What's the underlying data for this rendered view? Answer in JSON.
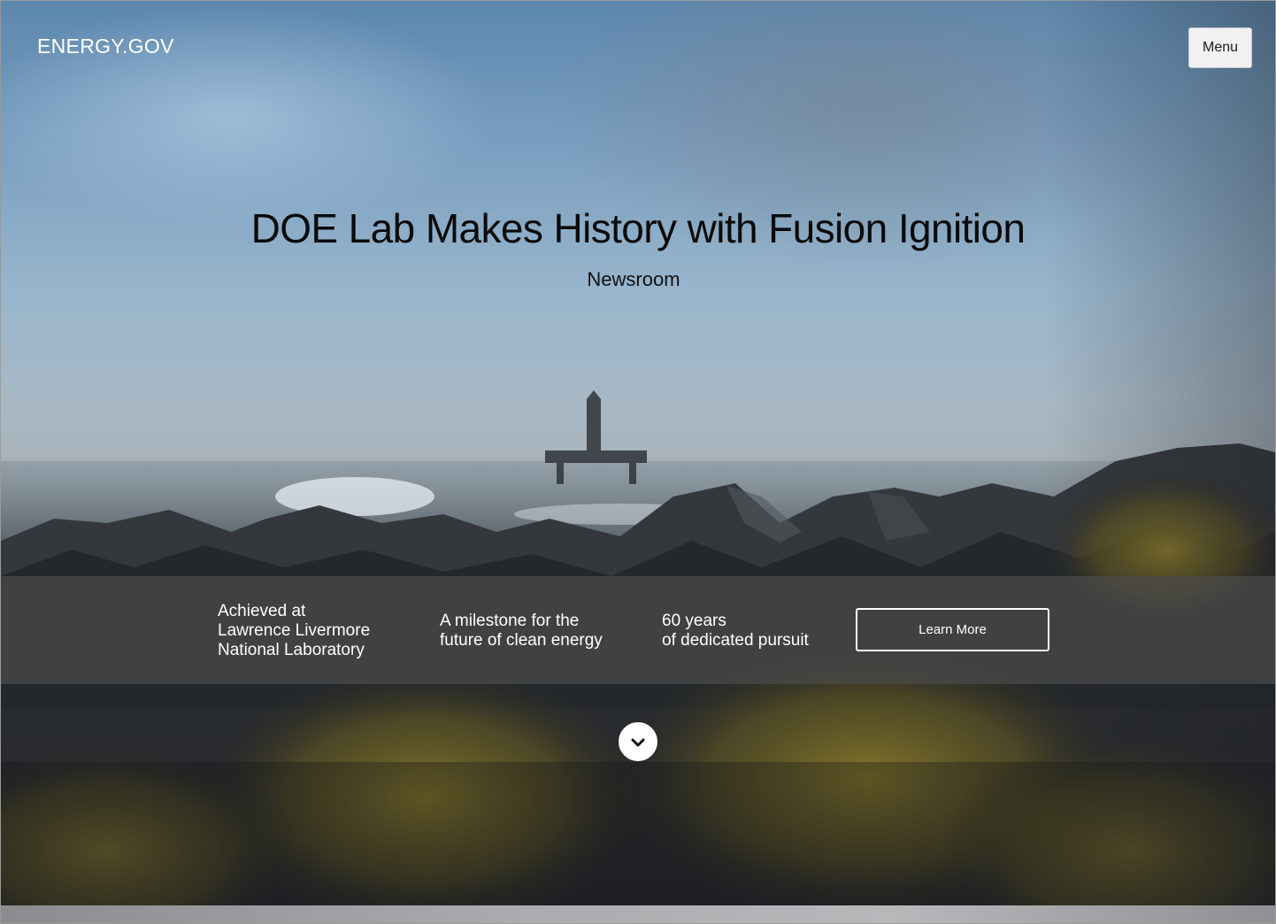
{
  "header": {
    "logo": "ENERGY.GOV",
    "menu_label": "Menu"
  },
  "hero": {
    "title": "DOE Lab Makes History with Fusion Ignition",
    "subtitle": "Newsroom"
  },
  "highlights": [
    {
      "text": "Achieved at\nLawrence Livermore\nNational Laboratory"
    },
    {
      "text": "A milestone for the\nfuture of clean energy"
    },
    {
      "text": "60 years\nof dedicated pursuit"
    }
  ],
  "cta": {
    "label": "Learn More"
  },
  "icons": {
    "scroll": "chevron-down-icon"
  },
  "colors": {
    "band": "#4b4b4b",
    "button_border": "#ffffff",
    "menu_bg": "#f1f1f3"
  }
}
